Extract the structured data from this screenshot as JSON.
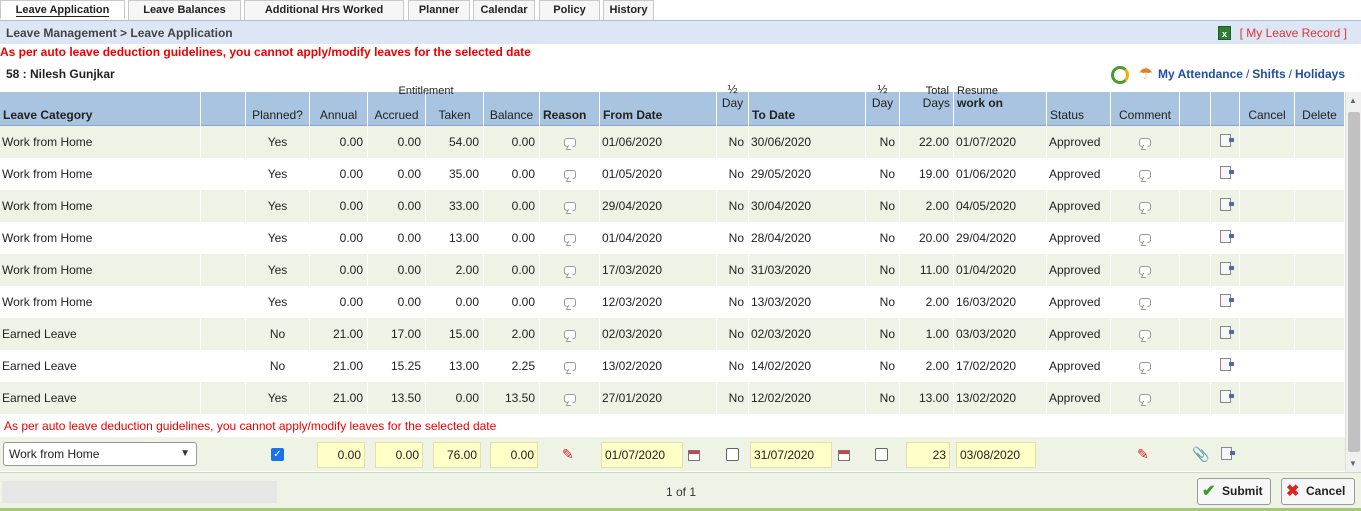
{
  "tabs": [
    "Leave Application",
    "Leave Balances",
    "Additional Hrs Worked",
    "Planner",
    "Calendar",
    "Policy",
    "History"
  ],
  "breadcrumb": "Leave Management > Leave Application",
  "my_leave_record": "[ My Leave Record ]",
  "error_message": "As per auto leave deduction guidelines, you cannot apply/modify leaves for the selected date",
  "employee": "58 : Nilesh Gunjkar",
  "links": {
    "attendance": "My Attendance",
    "shifts": "Shifts",
    "holidays": "Holidays",
    "sep": "/"
  },
  "columns": {
    "leave_category": "Leave Category",
    "planned": "Planned?",
    "entitlement": "Entitlement",
    "annual": "Annual",
    "accrued": "Accrued",
    "taken": "Taken",
    "balance": "Balance",
    "reason": "Reason",
    "from_date": "From Date",
    "half_day": "½ Day",
    "to_date": "To Date",
    "total_days_top": "Total",
    "days": "Days",
    "resume_top": "Resume",
    "work_on": "work on",
    "status": "Status",
    "comment": "Comment",
    "cancel": "Cancel",
    "delete": "Delete"
  },
  "rows": [
    {
      "category": "Work from Home",
      "planned": "Yes",
      "annual": "0.00",
      "accrued": "0.00",
      "taken": "54.00",
      "balance": "0.00",
      "from": "01/06/2020",
      "from_half": "No",
      "to": "30/06/2020",
      "to_half": "No",
      "days": "22.00",
      "resume": "01/07/2020",
      "status": "Approved"
    },
    {
      "category": "Work from Home",
      "planned": "Yes",
      "annual": "0.00",
      "accrued": "0.00",
      "taken": "35.00",
      "balance": "0.00",
      "from": "01/05/2020",
      "from_half": "No",
      "to": "29/05/2020",
      "to_half": "No",
      "days": "19.00",
      "resume": "01/06/2020",
      "status": "Approved"
    },
    {
      "category": "Work from Home",
      "planned": "Yes",
      "annual": "0.00",
      "accrued": "0.00",
      "taken": "33.00",
      "balance": "0.00",
      "from": "29/04/2020",
      "from_half": "No",
      "to": "30/04/2020",
      "to_half": "No",
      "days": "2.00",
      "resume": "04/05/2020",
      "status": "Approved"
    },
    {
      "category": "Work from Home",
      "planned": "Yes",
      "annual": "0.00",
      "accrued": "0.00",
      "taken": "13.00",
      "balance": "0.00",
      "from": "01/04/2020",
      "from_half": "No",
      "to": "28/04/2020",
      "to_half": "No",
      "days": "20.00",
      "resume": "29/04/2020",
      "status": "Approved"
    },
    {
      "category": "Work from Home",
      "planned": "Yes",
      "annual": "0.00",
      "accrued": "0.00",
      "taken": "2.00",
      "balance": "0.00",
      "from": "17/03/2020",
      "from_half": "No",
      "to": "31/03/2020",
      "to_half": "No",
      "days": "11.00",
      "resume": "01/04/2020",
      "status": "Approved"
    },
    {
      "category": "Work from Home",
      "planned": "Yes",
      "annual": "0.00",
      "accrued": "0.00",
      "taken": "0.00",
      "balance": "0.00",
      "from": "12/03/2020",
      "from_half": "No",
      "to": "13/03/2020",
      "to_half": "No",
      "days": "2.00",
      "resume": "16/03/2020",
      "status": "Approved"
    },
    {
      "category": "Earned Leave",
      "planned": "No",
      "annual": "21.00",
      "accrued": "17.00",
      "taken": "15.00",
      "balance": "2.00",
      "from": "02/03/2020",
      "from_half": "No",
      "to": "02/03/2020",
      "to_half": "No",
      "days": "1.00",
      "resume": "03/03/2020",
      "status": "Approved"
    },
    {
      "category": "Earned Leave",
      "planned": "No",
      "annual": "21.00",
      "accrued": "15.25",
      "taken": "13.00",
      "balance": "2.25",
      "from": "13/02/2020",
      "from_half": "No",
      "to": "14/02/2020",
      "to_half": "No",
      "days": "2.00",
      "resume": "17/02/2020",
      "status": "Approved"
    },
    {
      "category": "Earned Leave",
      "planned": "Yes",
      "annual": "21.00",
      "accrued": "13.50",
      "taken": "0.00",
      "balance": "13.50",
      "from": "27/01/2020",
      "from_half": "No",
      "to": "12/02/2020",
      "to_half": "No",
      "days": "13.00",
      "resume": "13/02/2020",
      "status": "Approved"
    }
  ],
  "warning_inline": "As per auto leave deduction guidelines, you cannot apply/modify leaves for the selected date",
  "entry": {
    "category": "Work from Home",
    "planned_checked": true,
    "annual": "0.00",
    "accrued": "0.00",
    "taken": "76.00",
    "balance": "0.00",
    "from": "01/07/2020",
    "to": "31/07/2020",
    "days": "23",
    "resume": "03/08/2020"
  },
  "pager": "1 of 1",
  "buttons": {
    "submit": "Submit",
    "cancel": "Cancel"
  },
  "colors": {
    "header": "#a9c4e0",
    "row_alt": "#eef3e6",
    "error": "#e00000",
    "input_bg": "#ffffc8"
  }
}
